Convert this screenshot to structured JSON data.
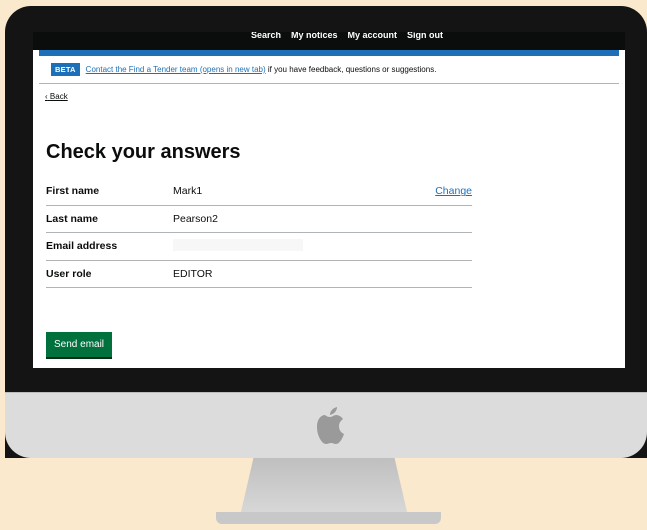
{
  "nav": {
    "links": [
      "Search",
      "My notices",
      "My account",
      "Sign out"
    ]
  },
  "beta": {
    "tag": "BETA",
    "link": "Contact the Find a Tender team (opens in new tab)",
    "suffix": " if you have feedback, questions or suggestions."
  },
  "back_label": "Back",
  "back_icon": "chevron-left",
  "title": "Check your answers",
  "summary": [
    {
      "key": "First name",
      "value": "Mark1",
      "action": "Change"
    },
    {
      "key": "Last name",
      "value": "Pearson2",
      "action": ""
    },
    {
      "key": "Email address",
      "value": "",
      "action": ""
    },
    {
      "key": "User role",
      "value": "EDITOR",
      "action": ""
    }
  ],
  "send_button": "Send email",
  "colors": {
    "link": "#1d70b8",
    "button": "#00703c",
    "header": "#0b0c0c",
    "background": "#fbe9cd"
  }
}
